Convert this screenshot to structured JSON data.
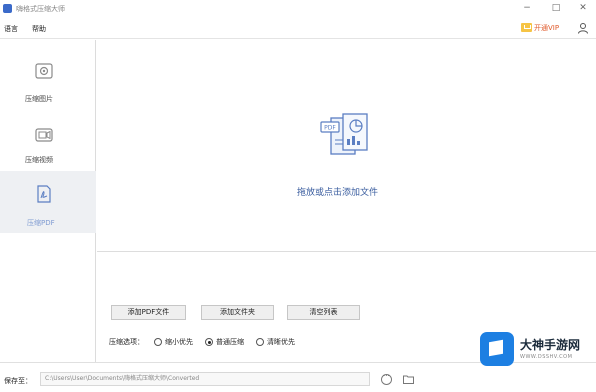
{
  "window": {
    "title": "嗨格式压缩大师"
  },
  "menu": {
    "items": [
      "语言",
      "帮助"
    ],
    "vip_label": "开通VIP"
  },
  "sidebar": {
    "items": [
      {
        "label": "压缩图片",
        "icon": "image-compress-icon",
        "active": false
      },
      {
        "label": "压缩视频",
        "icon": "video-compress-icon",
        "active": false
      },
      {
        "label": "压缩PDF",
        "icon": "pdf-compress-icon",
        "active": true
      }
    ]
  },
  "main": {
    "drop_text": "拖放或点击添加文件",
    "buttons": {
      "add_pdf": "添加PDF文件",
      "add_folder": "添加文件夹",
      "clear_list": "清空列表"
    },
    "options": {
      "label": "压缩选项：",
      "choices": [
        "缩小优先",
        "普通压缩",
        "清晰优先"
      ],
      "selected": "普通压缩"
    }
  },
  "footer": {
    "save_label": "保存至：",
    "save_path": "C:\\Users\\User\\Documents\\嗨格式压缩大师\\Converted"
  },
  "watermark": {
    "title": "大神手游网",
    "url": "WWW.DSSHV.COM"
  },
  "colors": {
    "accent": "#3a5d9f",
    "vip": "#e05a2b",
    "active_bg": "#eef0f3"
  }
}
